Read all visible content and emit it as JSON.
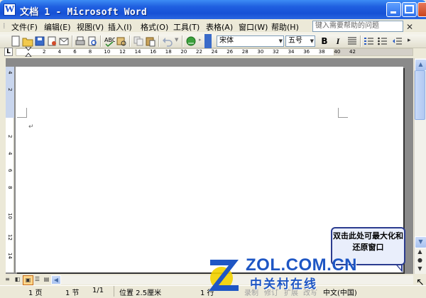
{
  "window": {
    "title": "文档 1 - Microsoft Word",
    "app_icon": "word-icon"
  },
  "menubar": {
    "items": [
      "文件(F)",
      "编辑(E)",
      "视图(V)",
      "插入(I)",
      "格式(O)",
      "工具(T)",
      "表格(A)",
      "窗口(W)",
      "帮助(H)"
    ],
    "help_placeholder": "键入需要帮助的问题"
  },
  "toolbar": {
    "font": "宋体",
    "size": "五号",
    "bold": "B",
    "italic": "I"
  },
  "ruler": {
    "tab_selector": "L",
    "ticks": [
      "2",
      "4",
      "6",
      "8",
      "10",
      "12",
      "14",
      "16",
      "18",
      "20",
      "22",
      "24",
      "26",
      "28",
      "30",
      "32",
      "34",
      "36",
      "38",
      "40",
      "42"
    ],
    "vticks": [
      "4",
      "2",
      "2",
      "4",
      "6",
      "8",
      "10",
      "12",
      "14"
    ]
  },
  "callout": {
    "text": "双击此处可最大化和还原窗口"
  },
  "statusbar": {
    "page": "1 页",
    "section": "1 节",
    "pages": "1/1",
    "position": "位置 2.5厘米",
    "line": "1 行",
    "rec": "录制",
    "trk": "修订",
    "ext": "扩展",
    "ovr": "改写",
    "language": "中文(中国)"
  },
  "watermark": {
    "brand": "ZOL.COM.CN",
    "brand_cn": "中关村在线"
  },
  "colors": {
    "title_bar": "#1F5FE0",
    "chrome": "#ECE9D8",
    "callout_border": "#2B3C8F",
    "watermark": "#1E56C4"
  }
}
